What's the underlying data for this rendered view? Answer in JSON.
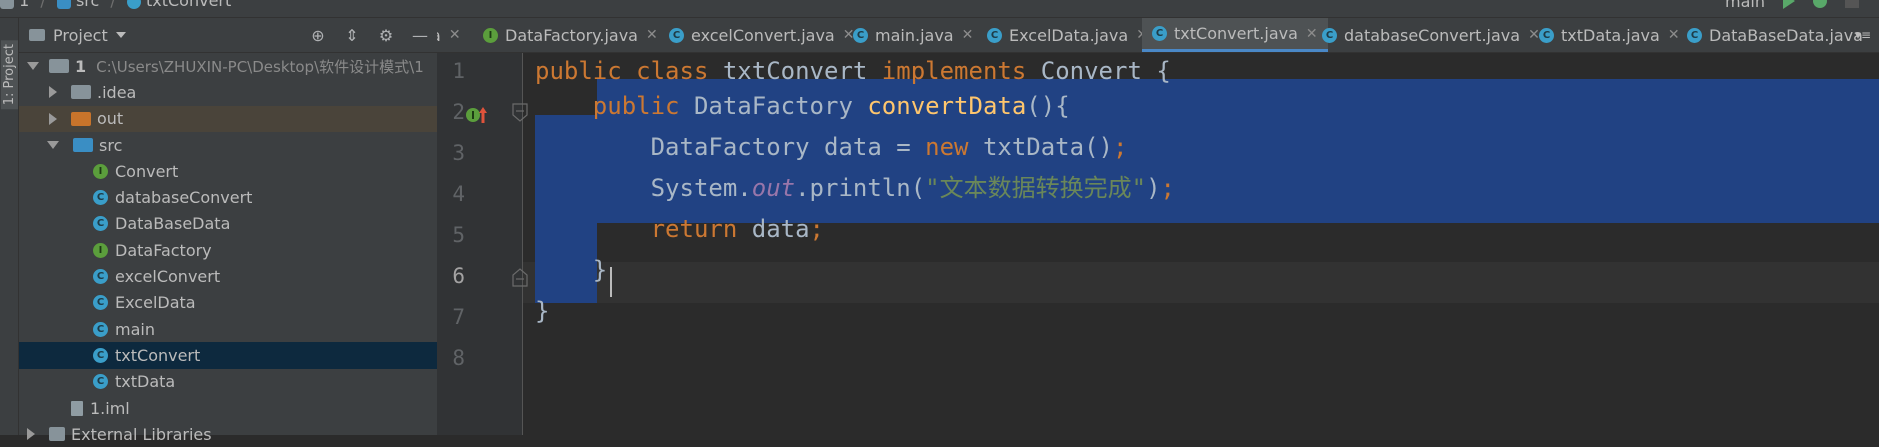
{
  "breadcrumb": {
    "items": [
      "1",
      "src",
      "txtConvert"
    ]
  },
  "run_toolbar": {
    "config_label": "main"
  },
  "tool_stripe": {
    "label": "1: Project"
  },
  "project_panel": {
    "title": "Project",
    "tree": [
      {
        "label": "1",
        "path": "C:\\Users\\ZHUXIN-PC\\Desktop\\软件设计模式\\1"
      },
      {
        "label": ".idea"
      },
      {
        "label": "out"
      },
      {
        "label": "src"
      },
      {
        "label": "Convert"
      },
      {
        "label": "databaseConvert"
      },
      {
        "label": "DataBaseData"
      },
      {
        "label": "DataFactory"
      },
      {
        "label": "excelConvert"
      },
      {
        "label": "ExcelData"
      },
      {
        "label": "main"
      },
      {
        "label": "txtConvert"
      },
      {
        "label": "txtData"
      },
      {
        "label": "1.iml"
      },
      {
        "label": "External Libraries"
      }
    ]
  },
  "tabs": [
    {
      "label": "a"
    },
    {
      "label": "DataFactory.java"
    },
    {
      "label": "excelConvert.java"
    },
    {
      "label": "main.java"
    },
    {
      "label": "ExcelData.java"
    },
    {
      "label": "txtConvert.java",
      "active": true
    },
    {
      "label": "databaseConvert.java"
    },
    {
      "label": "txtData.java"
    },
    {
      "label": "DataBaseData.java"
    }
  ],
  "editor": {
    "line_numbers": [
      "1",
      "2",
      "3",
      "4",
      "5",
      "6",
      "7",
      "8"
    ],
    "current_line": 6
  },
  "colors": {
    "background": "#2b2b2b",
    "panel": "#3c3f41",
    "selection": "#214283",
    "keyword": "#cc7832",
    "string": "#6a8759",
    "method": "#ffc66d",
    "field": "#9876aa",
    "text": "#a9b7c6"
  }
}
